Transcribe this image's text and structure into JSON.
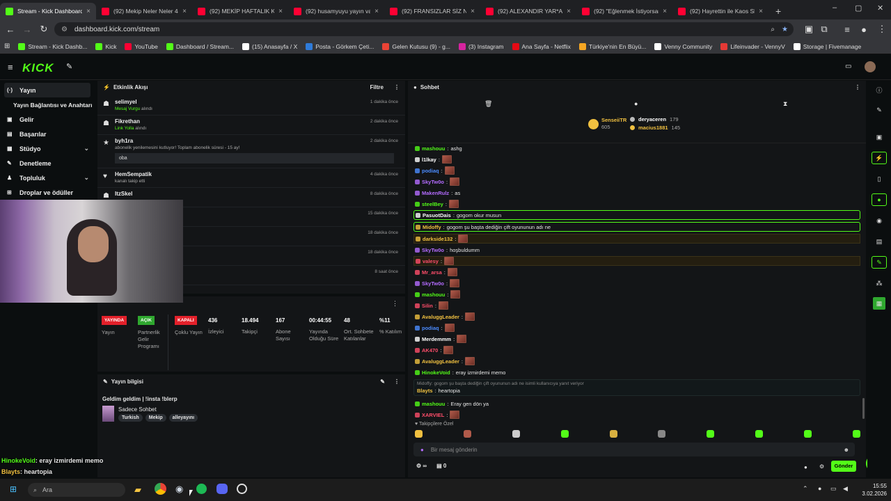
{
  "tabs": [
    {
      "label": "Stream - Kick Dashboard",
      "color": "#53fc18",
      "active": true
    },
    {
      "label": "(92) Mekip Neler Neler 4#",
      "color": "#ff0033"
    },
    {
      "label": "(92) MEKİP HAFTALIK KO",
      "color": "#ff0033"
    },
    {
      "label": "(92) husamyuyu yayın val",
      "color": "#ff0033"
    },
    {
      "label": "(92) FRANSIZLAR SİZ NA",
      "color": "#ff0033"
    },
    {
      "label": "(92) ALEXANDIR YAR*AK",
      "color": "#ff0033"
    },
    {
      "label": "(92) \"Eğlenmek İstiyorsan",
      "color": "#ff0033"
    },
    {
      "label": "(92) Hayrettin ile Kaos Sh",
      "color": "#ff0033"
    }
  ],
  "address": {
    "url": "dashboard.kick.com/stream"
  },
  "bookmarks": [
    {
      "label": "Stream - Kick Dashb...",
      "color": "#53fc18"
    },
    {
      "label": "Kick",
      "color": "#53fc18"
    },
    {
      "label": "YouTube",
      "color": "#ff0033"
    },
    {
      "label": "Dashboard / Stream...",
      "color": "#53fc18"
    },
    {
      "label": "(15) Anasayfa / X",
      "color": "#ffffff"
    },
    {
      "label": "Posta - Görkem Çeti...",
      "color": "#2f7bd9"
    },
    {
      "label": "Gelen Kutusu (9) - g...",
      "color": "#ea4335"
    },
    {
      "label": "(3) Instagram",
      "color": "#d6249f"
    },
    {
      "label": "Ana Sayfa - Netflix",
      "color": "#e50914"
    },
    {
      "label": "Türkiye'nin En Büyü...",
      "color": "#f5a623"
    },
    {
      "label": "Venny Community",
      "color": "#ffffff"
    },
    {
      "label": "Lifeinvader - VennyV",
      "color": "#e53935"
    },
    {
      "label": "Storage | Fivemanage",
      "color": "#ffffff"
    }
  ],
  "sidebar": {
    "items": [
      {
        "label": "Yayın",
        "icon": "broadcast-icon"
      },
      {
        "label": "Yayın Bağlantısı ve Anahtarı",
        "icon": ""
      },
      {
        "label": "Gelir",
        "icon": "wallet-icon"
      },
      {
        "label": "Başarılar",
        "icon": "trophy-icon"
      },
      {
        "label": "Stüdyo",
        "icon": "studio-icon"
      },
      {
        "label": "Denetleme",
        "icon": "hammer-icon"
      },
      {
        "label": "Topluluk",
        "icon": "community-icon"
      },
      {
        "label": "Droplar ve ödüller",
        "icon": "gift-icon"
      }
    ]
  },
  "activity": {
    "title": "Etkinlik Akışı",
    "filter": "Filtre",
    "items": [
      {
        "name": "selimyel",
        "hl": "Mesaj Vurgu",
        "desc": " alındı",
        "time": "1 dakika önce"
      },
      {
        "name": "Fikrethan",
        "hl": "Link Yolla",
        "desc": " alındı",
        "time": "2 dakika önce"
      },
      {
        "name": "byh1ra",
        "hl": "",
        "desc": "abonelik yenilemesini kutluyor! Toplam abonelik süresi - 15 ay!",
        "time": "2 dakika önce",
        "msg": "oba"
      },
      {
        "name": "HemSempatik",
        "hl": "",
        "desc": "kanalı takip etti",
        "time": "4 dakika önce"
      },
      {
        "name": "ItzSkel",
        "hl": "",
        "desc": "",
        "time": "8 dakika önce"
      },
      {
        "name": "",
        "hl": "",
        "desc": "",
        "time": "15 dakika önce"
      },
      {
        "name": "",
        "hl": "",
        "desc": "",
        "time": "18 dakika önce"
      },
      {
        "name": "",
        "hl": "",
        "desc": "",
        "time": "18 dakika önce"
      },
      {
        "name": "",
        "hl": "",
        "desc": "",
        "time": "8 saat önce"
      }
    ]
  },
  "stats": {
    "badges": [
      {
        "badge": "YAYINDA",
        "label": "Yayın",
        "color": "#e3202a"
      },
      {
        "badge": "AÇIK",
        "label": "Partnerlik Gelir Programı",
        "color": "#2fa82f"
      },
      {
        "badge": "KAPALI",
        "label": "Çoklu Yayın",
        "color": "#e3202a"
      }
    ],
    "values": [
      {
        "value": "436",
        "label": "İzleyici"
      },
      {
        "value": "18.494",
        "label": "Takipçi"
      },
      {
        "value": "167",
        "label": "Abone Sayısı"
      },
      {
        "value": "00:44:55",
        "label": "Yayında Olduğu Süre"
      },
      {
        "value": "48",
        "label": "Ort. Sohbete Katılanlar"
      },
      {
        "value": "%11",
        "label": "% Katılım"
      }
    ]
  },
  "info": {
    "title": "Yayın bilgisi",
    "stream_title": "Geldim geldim | !insta !blerp",
    "category": "Sadece Sohbet",
    "tags": [
      "Turkish",
      "Mekip",
      "alleyayını"
    ]
  },
  "chat": {
    "title": "Sohbet",
    "leaders": [
      {
        "name": "SenseiiTR",
        "value": "605"
      },
      {
        "name": "deryaceren",
        "value": "179"
      },
      {
        "name": "macius1881",
        "value": "145"
      }
    ],
    "messages": [
      {
        "user": "mashouu",
        "color": "#53fc18",
        "text": "ashg",
        "emote": false
      },
      {
        "user": "l1lkay",
        "color": "#ffffff",
        "text": "",
        "emote": true
      },
      {
        "user": "podiaq",
        "color": "#4b8cff",
        "text": "",
        "emote": true
      },
      {
        "user": "SkyTw0o",
        "color": "#b46cff",
        "text": "",
        "emote": true
      },
      {
        "user": "MakenRulz",
        "color": "#b46cff",
        "text": "as",
        "emote": false
      },
      {
        "user": "steelBey",
        "color": "#53fc18",
        "text": "",
        "emote": true
      },
      {
        "user": "PasuotDais",
        "color": "#ffffff",
        "text": "gogom okur musun",
        "emote": false,
        "style": "hl"
      },
      {
        "user": "Midoffy",
        "color": "#f0c040",
        "text": "gogom şu başta dediğin çift oyununun adı ne",
        "emote": false,
        "style": "hl"
      },
      {
        "user": "darkside132",
        "color": "#f0c040",
        "text": "",
        "emote": true,
        "style": "gold"
      },
      {
        "user": "SkyTw0o",
        "color": "#b46cff",
        "text": "hoşbuldumm",
        "emote": false
      },
      {
        "user": "valesy",
        "color": "#ff4d6a",
        "text": "",
        "emote": true,
        "style": "gold"
      },
      {
        "user": "Mr_arsa",
        "color": "#ff4d6a",
        "text": "",
        "emote": true
      },
      {
        "user": "SkyTw0o",
        "color": "#b46cff",
        "text": "",
        "emote": true
      },
      {
        "user": "mashouu",
        "color": "#53fc18",
        "text": "",
        "emote": true
      },
      {
        "user": "Silin",
        "color": "#ff4d6a",
        "text": "",
        "emote": true
      },
      {
        "user": "AvaluggLeader",
        "color": "#f0c040",
        "text": "",
        "emote": true
      },
      {
        "user": "podiaq",
        "color": "#4b8cff",
        "text": "",
        "emote": true
      },
      {
        "user": "Merdemmm",
        "color": "#ffffff",
        "text": "",
        "emote": true
      },
      {
        "user": "AK470",
        "color": "#ff4d6a",
        "text": "",
        "emote": true
      },
      {
        "user": "AvaluggLeader",
        "color": "#f0c040",
        "text": "",
        "emote": true
      },
      {
        "user": "HinokeVoid",
        "color": "#53fc18",
        "text": "eray izmirdemi memo",
        "emote": false
      }
    ],
    "reply_ref": "Midoffy: gogom şu başta dediğin çift oyununun adı ne isimli kullanıcıya yanıt veriyor",
    "reply": {
      "user": "Blayts",
      "color": "#f0c040",
      "text": "heartopia"
    },
    "after": [
      {
        "user": "mashouu",
        "color": "#53fc18",
        "text": "Eray gen dön ya",
        "emote": false
      },
      {
        "user": "XARVIEL",
        "color": "#ff4d6a",
        "text": "",
        "emote": true
      }
    ],
    "emote_label": "Takipçilere Özel",
    "input_placeholder": "Bir mesaj gönderin",
    "send_label": "Gönder",
    "points": "∞",
    "count": "0"
  },
  "overlay": {
    "lines": [
      {
        "user": "HinokeVoid",
        "color": "#53fc18",
        "text": ": eray izmirdemi memo"
      },
      {
        "user": "Blayts",
        "color": "#f0c040",
        "text": ": heartopia"
      },
      {
        "user": "mashouu",
        "color": "#53fc18",
        "text": ": Eray gen dön ya"
      },
      {
        "user": "XARVIEL",
        "color": "#ff4d6a",
        "text": ":"
      }
    ]
  },
  "taskbar": {
    "search": "Ara",
    "time": "15:55",
    "date": "3.02.2026"
  }
}
